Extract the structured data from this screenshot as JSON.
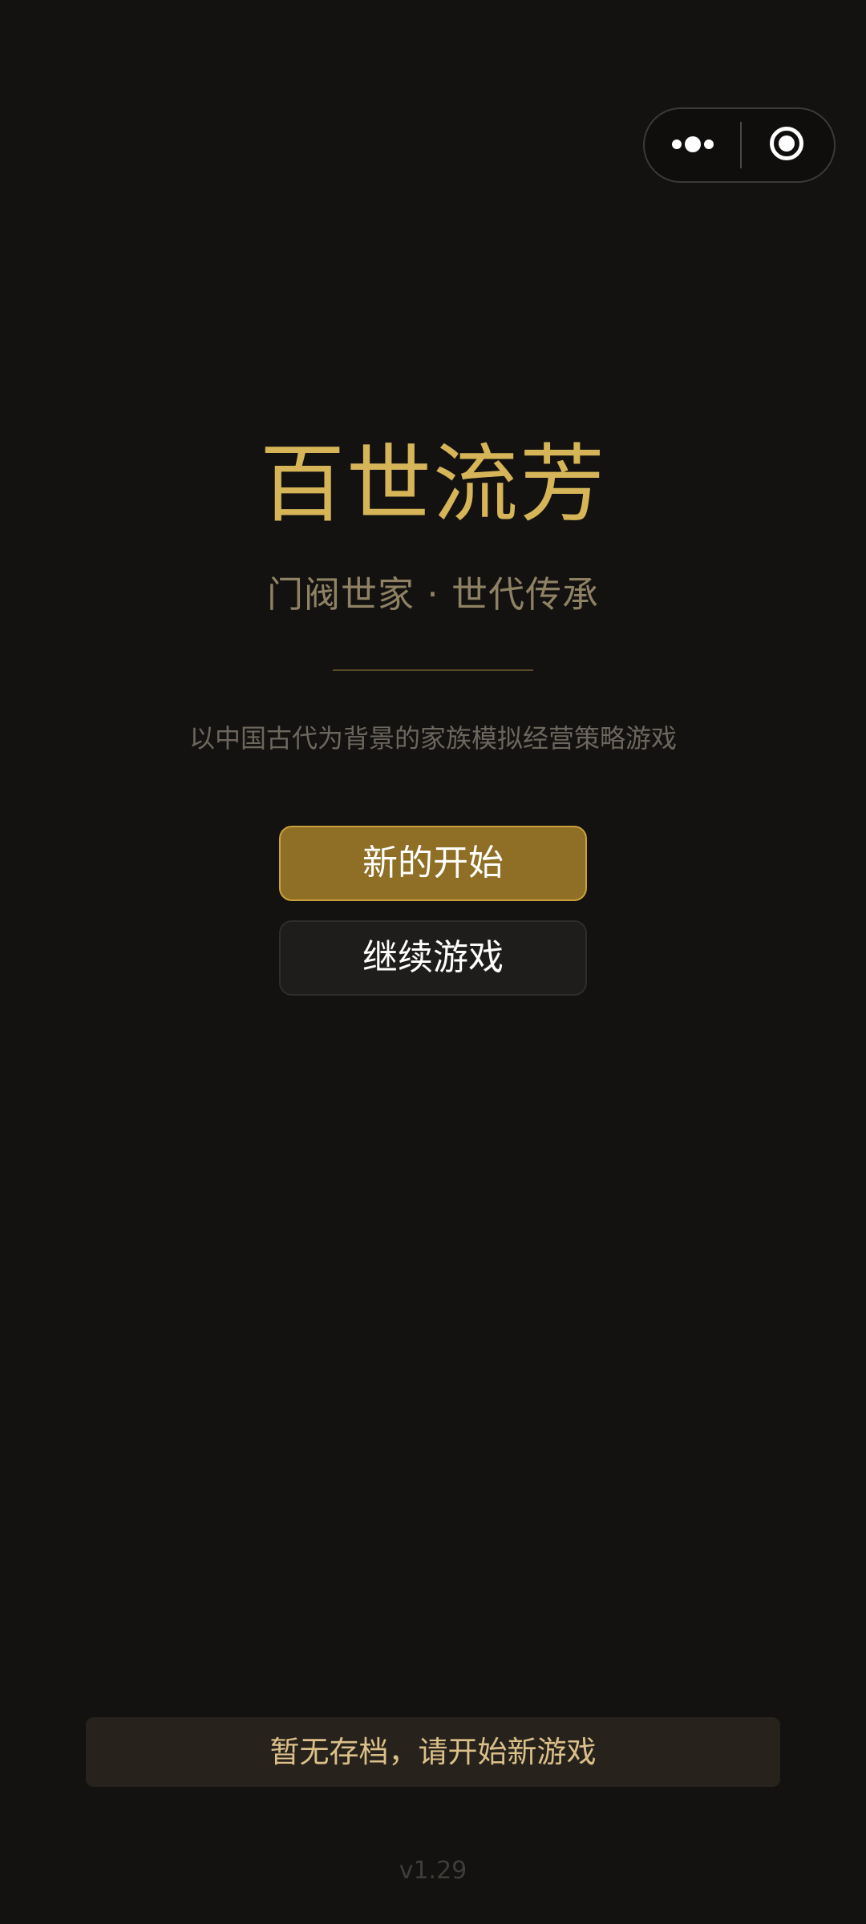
{
  "capsule": {
    "more_icon": "more-dots-icon",
    "close_icon": "target-circle-icon"
  },
  "title": "百世流芳",
  "subtitle": "门阀世家 · 世代传承",
  "description": "以中国古代为背景的家族模拟经营策略游戏",
  "buttons": {
    "new_game": "新的开始",
    "continue": "继续游戏"
  },
  "notice": "暂无存档，请开始新游戏",
  "version": "v1.29",
  "colors": {
    "background": "#131210",
    "title_gold": "#d6b458",
    "primary_button": "#8f6e25",
    "secondary_button": "#1f1d1b",
    "notice_text": "#dcc08a"
  }
}
